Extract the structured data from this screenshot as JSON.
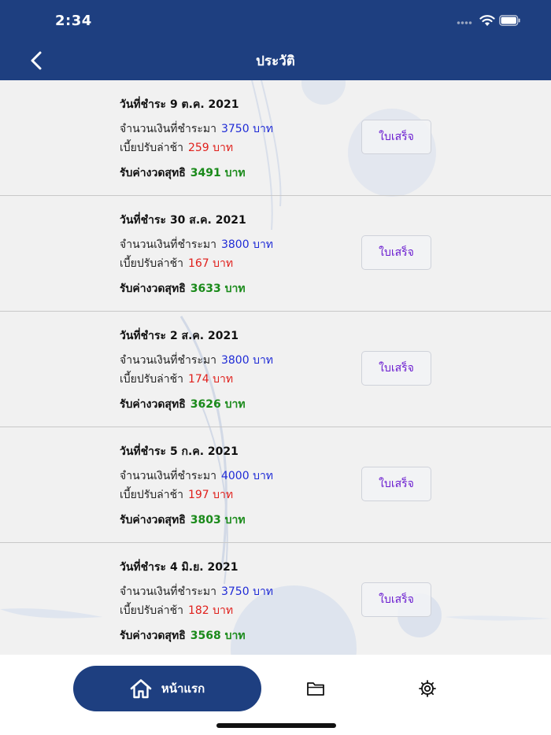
{
  "status_bar": {
    "time": "2:34"
  },
  "header": {
    "title": "ประวัติ",
    "back_icon": "chevron-left-icon"
  },
  "labels": {
    "date_prefix": "วันที่ชำระ",
    "amount_label": "จำนวนเงินที่ชำระมา",
    "fine_label": "เบี้ยปรับล่าช้า",
    "net_label": "รับค่างวดสุทธิ",
    "receipt_button": "ใบเสร็จ"
  },
  "payments": [
    {
      "date": "9 ต.ค. 2021",
      "amount": "3750 บาท",
      "fine": "259 บาท",
      "net": "3491 บาท"
    },
    {
      "date": "30 ส.ค. 2021",
      "amount": "3800 บาท",
      "fine": "167 บาท",
      "net": "3633 บาท"
    },
    {
      "date": "2 ส.ค. 2021",
      "amount": "3800 บาท",
      "fine": "174 บาท",
      "net": "3626 บาท"
    },
    {
      "date": "5 ก.ค. 2021",
      "amount": "4000 บาท",
      "fine": "197 บาท",
      "net": "3803 บาท"
    },
    {
      "date": "4 มิ.ย. 2021",
      "amount": "3750 บาท",
      "fine": "182 บาท",
      "net": "3568 บาท"
    }
  ],
  "tab_bar": {
    "home_label": "หน้าแรก",
    "home_icon": "home-icon",
    "folder_icon": "folder-icon",
    "settings_icon": "gear-icon"
  },
  "colors": {
    "primary": "#1e3f80",
    "amount": "#1f2bd6",
    "fine": "#e0201c",
    "net": "#1a8a1a",
    "receipt_text": "#6a1bd0"
  }
}
